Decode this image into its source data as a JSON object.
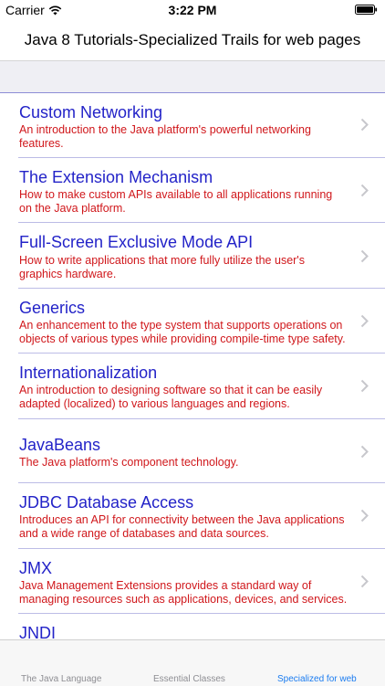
{
  "status_bar": {
    "carrier": "Carrier",
    "time": "3:22 PM"
  },
  "nav": {
    "title": "Java 8 Tutorials-Specialized Trails for web pages"
  },
  "colors": {
    "title": "#2323c8",
    "description": "#d0171b",
    "tab_active": "#1b7cf0",
    "tab_inactive": "#8e8e93"
  },
  "items": [
    {
      "title": "Custom Networking",
      "description": "An introduction to the Java platform's powerful networking features."
    },
    {
      "title": "The Extension Mechanism",
      "description": "How to make custom APIs available to all applications running on the Java platform."
    },
    {
      "title": "Full-Screen Exclusive Mode API",
      "description": "How to write applications that more fully utilize the user's graphics hardware."
    },
    {
      "title": "Generics",
      "description": "An enhancement to the type system that supports operations on objects of various types while providing compile-time type safety."
    },
    {
      "title": "Internationalization",
      "description": "An introduction to designing software so that it can be easily adapted (localized) to various languages and regions."
    },
    {
      "title": "JavaBeans",
      "description": "The Java platform's component technology."
    },
    {
      "title": "JDBC Database Access",
      "description": "Introduces an API for connectivity between the Java applications and a wide range of databases and data sources."
    },
    {
      "title": "JMX",
      "description": "Java Management Extensions provides a standard way of managing resources such as applications, devices, and services."
    },
    {
      "title": "JNDI",
      "description": ""
    }
  ],
  "tabs": [
    {
      "label": "The Java Language"
    },
    {
      "label": "Essential Classes"
    },
    {
      "label": "Specialized for web"
    }
  ]
}
